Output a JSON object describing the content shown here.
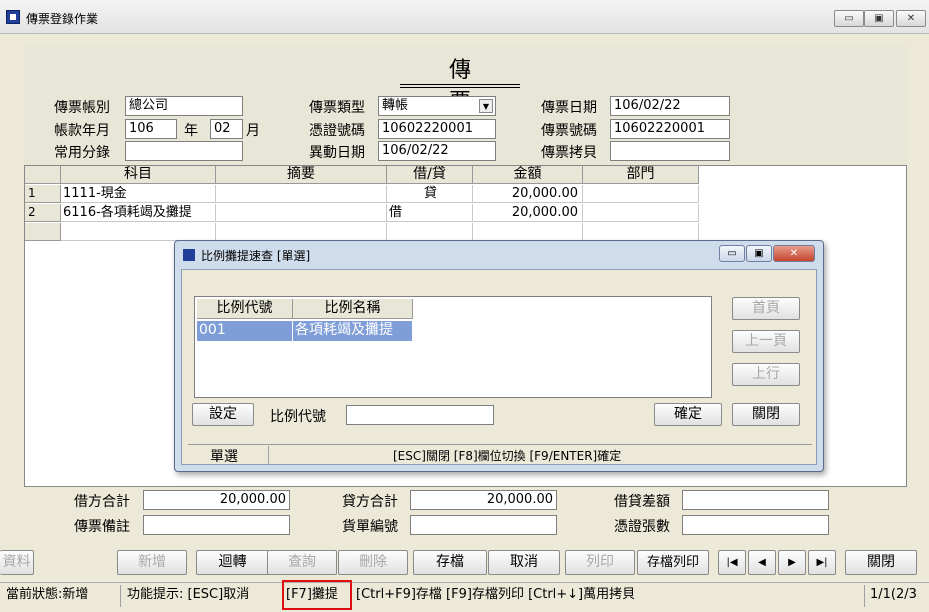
{
  "window": {
    "title": "傳票登錄作業",
    "min": "▭",
    "max": "▣",
    "close": "✕"
  },
  "form": {
    "title": "傳 票",
    "account_label": "傳票帳別",
    "account_value": "總公司",
    "type_label": "傳票類型",
    "type_value": "轉帳",
    "date_label": "傳票日期",
    "date_value": "106/02/22",
    "period_label": "帳款年月",
    "year_value": "106",
    "year_unit": "年",
    "month_value": "02",
    "month_unit": "月",
    "cert_no_label": "憑證號碼",
    "cert_no_value": "10602220001",
    "voucher_no_label": "傳票號碼",
    "voucher_no_value": "10602220001",
    "category_label": "常用分錄",
    "category_value": "",
    "change_date_label": "異動日期",
    "change_date_value": "106/02/22",
    "copy_label": "傳票拷貝",
    "copy_value": ""
  },
  "grid": {
    "headers": [
      "科目",
      "摘要",
      "借/貸",
      "金額",
      "部門"
    ],
    "rows": [
      {
        "no": "1",
        "subject": "1111-現金",
        "summary": "",
        "dc": "貸",
        "amount": "20,000.00",
        "dept": ""
      },
      {
        "no": "2",
        "subject": "6116-各項耗竭及攤提",
        "summary": "",
        "dc": "借",
        "amount": "20,000.00",
        "dept": ""
      }
    ]
  },
  "dialog": {
    "title": "比例攤提速查 [單選]",
    "list_headers": [
      "比例代號",
      "比例名稱"
    ],
    "list_rows": [
      {
        "code": "001",
        "name": "各項耗竭及攤提"
      }
    ],
    "first_page": "首頁",
    "prev_page": "上一頁",
    "prev_row": "上行",
    "settings": "設定",
    "code_label": "比例代號",
    "code_value": "",
    "confirm": "確定",
    "close": "關閉",
    "mode": "單選",
    "hint": "[ESC]關閉 [F8]欄位切換 [F9/ENTER]確定"
  },
  "totals": {
    "debit_label": "借方合計",
    "debit_value": "20,000.00",
    "credit_label": "貸方合計",
    "credit_value": "20,000.00",
    "diff_label": "借貸差額",
    "diff_value": "",
    "remark_label": "傳票備註",
    "remark_value": "",
    "bill_label": "貨單編號",
    "bill_value": "",
    "cert_count_label": "憑證張數",
    "cert_count_value": ""
  },
  "toolbar": {
    "data": "資料",
    "add": "新增",
    "transfer": "迴轉",
    "query": "查詢",
    "delete": "刪除",
    "save": "存檔",
    "cancel": "取消",
    "print": "列印",
    "save_print": "存檔列印",
    "first": "|◀",
    "prev": "◀",
    "next": "▶",
    "last": "▶|",
    "close": "關閉"
  },
  "statusbar": {
    "state": "當前狀態:新增",
    "hint_prefix": "功能提示: [ESC]取消",
    "f7": "[F7]攤提",
    "hint_suffix": "[Ctrl+F9]存檔 [F9]存檔列印 [Ctrl+↓]萬用拷貝",
    "page": "1/1(2/3"
  }
}
